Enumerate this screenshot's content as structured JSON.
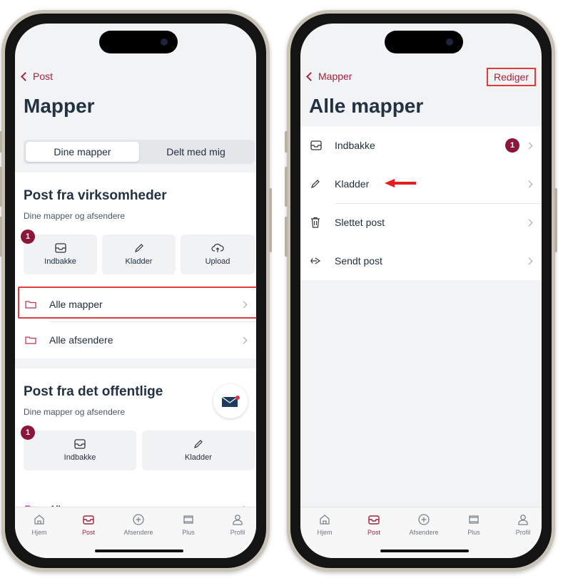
{
  "left": {
    "back_label": "Post",
    "title": "Mapper",
    "segment": {
      "tab1": "Dine mapper",
      "tab2": "Delt med mig"
    },
    "business": {
      "title": "Post fra virksomheder",
      "subtitle": "Dine mapper og afsendere",
      "badge": "1",
      "tiles": [
        "Indbakke",
        "Kladder",
        "Upload"
      ],
      "rows": [
        "Alle mapper",
        "Alle afsendere"
      ]
    },
    "public": {
      "title": "Post fra det offentlige",
      "subtitle": "Dine mapper og afsendere",
      "badge": "1",
      "tiles": [
        "Indbakke",
        "Kladder"
      ],
      "rows": [
        "Alle mapper"
      ]
    }
  },
  "right": {
    "back_label": "Mapper",
    "edit_label": "Rediger",
    "title": "Alle mapper",
    "rows": [
      {
        "label": "Indbakke",
        "icon": "inbox-icon",
        "badge": "1"
      },
      {
        "label": "Kladder",
        "icon": "pencil-icon"
      },
      {
        "label": "Slettet post",
        "icon": "trash-icon"
      },
      {
        "label": "Sendt post",
        "icon": "send-icon"
      }
    ]
  },
  "tabbar": {
    "items": [
      "Hjem",
      "Post",
      "Afsendere",
      "Plus",
      "Profil"
    ],
    "active": "Post"
  },
  "colors": {
    "accent": "#a8213d",
    "badge": "#8c1639",
    "highlight": "#e23b3b",
    "background": "#f2f3f5"
  }
}
